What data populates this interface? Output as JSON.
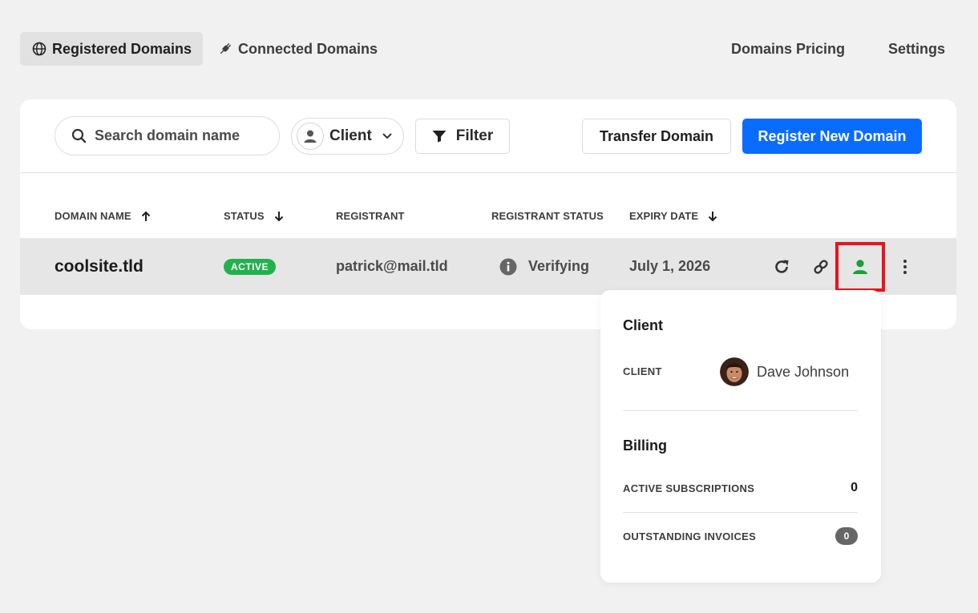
{
  "nav": {
    "tabs": [
      {
        "label": "Registered Domains",
        "icon": "globe-icon",
        "active": true
      },
      {
        "label": "Connected Domains",
        "icon": "plug-icon",
        "active": false
      }
    ],
    "pricing": "Domains Pricing",
    "settings": "Settings"
  },
  "toolbar": {
    "search_placeholder": "Search domain name",
    "client_label": "Client",
    "filter_label": "Filter",
    "transfer_label": "Transfer Domain",
    "register_label": "Register New Domain"
  },
  "table": {
    "headers": {
      "name": "DOMAIN NAME",
      "status": "STATUS",
      "registrant": "REGISTRANT",
      "registrant_status": "REGISTRANT STATUS",
      "expiry": "EXPIRY DATE"
    },
    "rows": [
      {
        "domain": "coolsite.tld",
        "status": "ACTIVE",
        "registrant": "patrick@mail.tld",
        "registrant_status": "Verifying",
        "expiry": "July 1, 2026"
      }
    ]
  },
  "popover": {
    "client_title": "Client",
    "client_label": "CLIENT",
    "client_name": "Dave Johnson",
    "billing_title": "Billing",
    "subscriptions_label": "ACTIVE SUBSCRIPTIONS",
    "subscriptions_value": "0",
    "invoices_label": "OUTSTANDING INVOICES",
    "invoices_value": "0"
  },
  "colors": {
    "primary": "#0a6cff",
    "active_badge": "#22b24c",
    "client_icon": "#1aa033",
    "highlight": "#e8141d"
  }
}
